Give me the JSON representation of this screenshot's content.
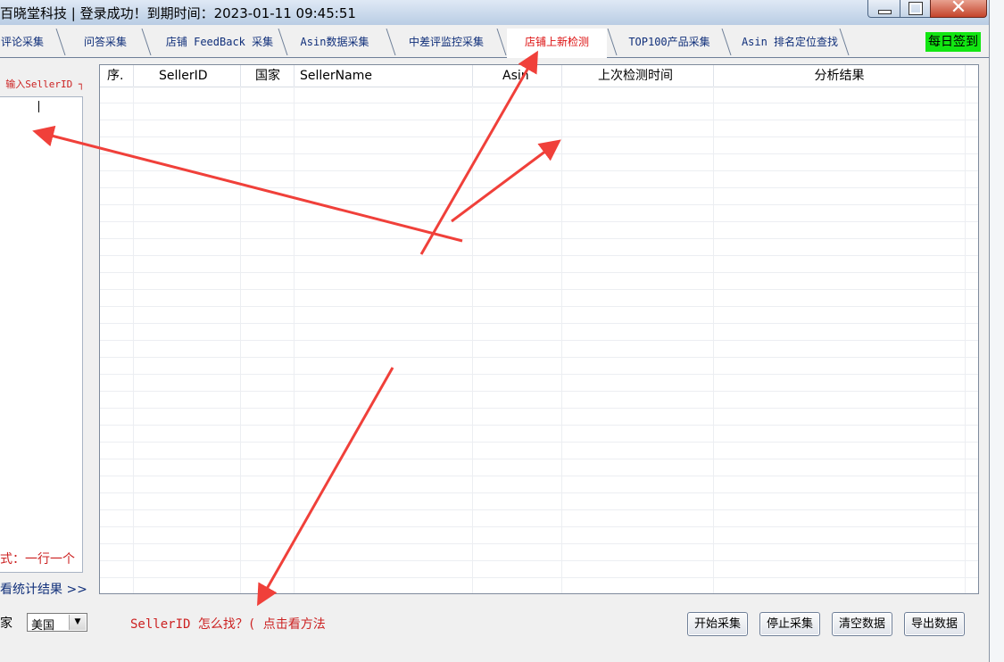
{
  "window": {
    "title": "百晓堂科技 | 登录成功！到期时间：2023-01-11 09:45:51"
  },
  "tabs": [
    {
      "label": "评论采集"
    },
    {
      "label": "问答采集"
    },
    {
      "label": "店铺 FeedBack 采集"
    },
    {
      "label": "Asin数据采集"
    },
    {
      "label": "中差评监控采集"
    },
    {
      "label": "店铺上新检测",
      "active": true
    },
    {
      "label": "TOP100产品采集"
    },
    {
      "label": "Asin 排名定位查找"
    }
  ],
  "daily_signin": "每日签到",
  "left_panel": {
    "caption": "┌ 输入SellerID ┐",
    "format_hint": "格式：一行一个",
    "view_stats": "查看统计结果 >>",
    "country_label": "国家",
    "country_value": "美国"
  },
  "grid": {
    "columns": [
      "序.",
      "SellerID",
      "国家",
      "SellerName",
      "Asin",
      "上次检测时间",
      "分析结果"
    ],
    "rows": []
  },
  "bottom": {
    "how_to_find": "SellerID 怎么找？( 点击看方法",
    "start": "开始采集",
    "stop": "停止采集",
    "clear": "清空数据",
    "export": "导出数据"
  },
  "colors": {
    "annotation_arrow": "#f0403a",
    "active_tab_text": "#dd1111",
    "signin_bg": "#12e612"
  }
}
